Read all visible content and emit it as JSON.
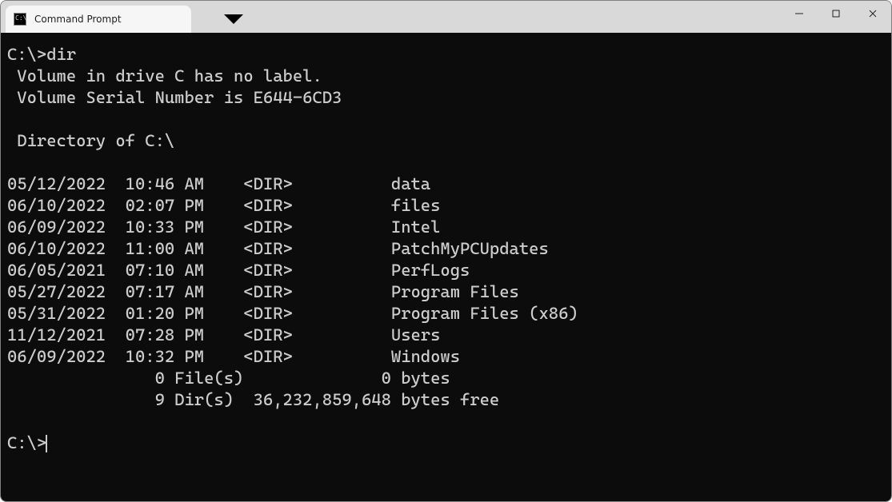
{
  "window": {
    "tab_title": "Command Prompt"
  },
  "terminal": {
    "prompt": "C:\\>",
    "command": "dir",
    "header_lines": [
      " Volume in drive C has no label.",
      " Volume Serial Number is E644-6CD3",
      "",
      " Directory of C:\\",
      ""
    ],
    "entries": [
      {
        "date": "05/12/2022",
        "time": "10:46 AM",
        "type": "<DIR>",
        "name": "data"
      },
      {
        "date": "06/10/2022",
        "time": "02:07 PM",
        "type": "<DIR>",
        "name": "files"
      },
      {
        "date": "06/09/2022",
        "time": "10:33 PM",
        "type": "<DIR>",
        "name": "Intel"
      },
      {
        "date": "06/10/2022",
        "time": "11:00 AM",
        "type": "<DIR>",
        "name": "PatchMyPCUpdates"
      },
      {
        "date": "06/05/2021",
        "time": "07:10 AM",
        "type": "<DIR>",
        "name": "PerfLogs"
      },
      {
        "date": "05/27/2022",
        "time": "07:17 AM",
        "type": "<DIR>",
        "name": "Program Files"
      },
      {
        "date": "05/31/2022",
        "time": "01:20 PM",
        "type": "<DIR>",
        "name": "Program Files (x86)"
      },
      {
        "date": "11/12/2021",
        "time": "07:28 PM",
        "type": "<DIR>",
        "name": "Users"
      },
      {
        "date": "06/09/2022",
        "time": "10:32 PM",
        "type": "<DIR>",
        "name": "Windows"
      }
    ],
    "summary_lines": [
      "               0 File(s)              0 bytes",
      "               9 Dir(s)  36,232,859,648 bytes free"
    ]
  }
}
